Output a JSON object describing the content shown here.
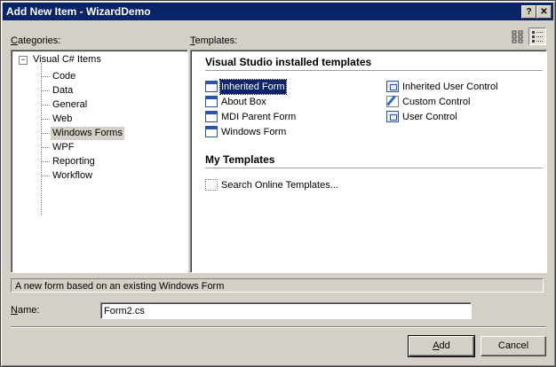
{
  "window": {
    "title": "Add New Item - WizardDemo",
    "help_glyph": "?",
    "close_glyph": "✕"
  },
  "categories": {
    "label_u": "C",
    "label_rest": "ategories:",
    "root": {
      "expander": "−",
      "label": "Visual C# Items"
    },
    "items": [
      {
        "label": "Code"
      },
      {
        "label": "Data"
      },
      {
        "label": "General"
      },
      {
        "label": "Web"
      },
      {
        "label": "Windows Forms",
        "selected": true
      },
      {
        "label": "WPF"
      },
      {
        "label": "Reporting"
      },
      {
        "label": "Workflow"
      }
    ]
  },
  "templates": {
    "label_u": "T",
    "label_rest": "emplates:",
    "installed_header": "Visual Studio installed templates",
    "installed": [
      {
        "label": "Inherited Form",
        "icon": "inherited-form-icon",
        "selected": true
      },
      {
        "label": "About Box",
        "icon": "about-box-icon"
      },
      {
        "label": "MDI Parent Form",
        "icon": "mdi-parent-form-icon"
      },
      {
        "label": "Windows Form",
        "icon": "windows-form-icon"
      },
      {
        "label": "Inherited User Control",
        "icon": "inherited-user-control-icon"
      },
      {
        "label": "Custom Control",
        "icon": "custom-control-icon"
      },
      {
        "label": "User Control",
        "icon": "user-control-icon"
      }
    ],
    "my_header": "My Templates",
    "my": [
      {
        "label": "Search Online Templates...",
        "icon": "search-online-icon"
      }
    ]
  },
  "description": "A new form based on an existing Windows Form",
  "name_field": {
    "label_u": "N",
    "label_rest": "ame:",
    "value": "Form2.cs"
  },
  "buttons": {
    "add_u": "A",
    "add_rest": "dd",
    "cancel": "Cancel"
  },
  "colors": {
    "selection": "#0a246a",
    "titlebar": "#0a246a",
    "face": "#d4d0c8"
  }
}
